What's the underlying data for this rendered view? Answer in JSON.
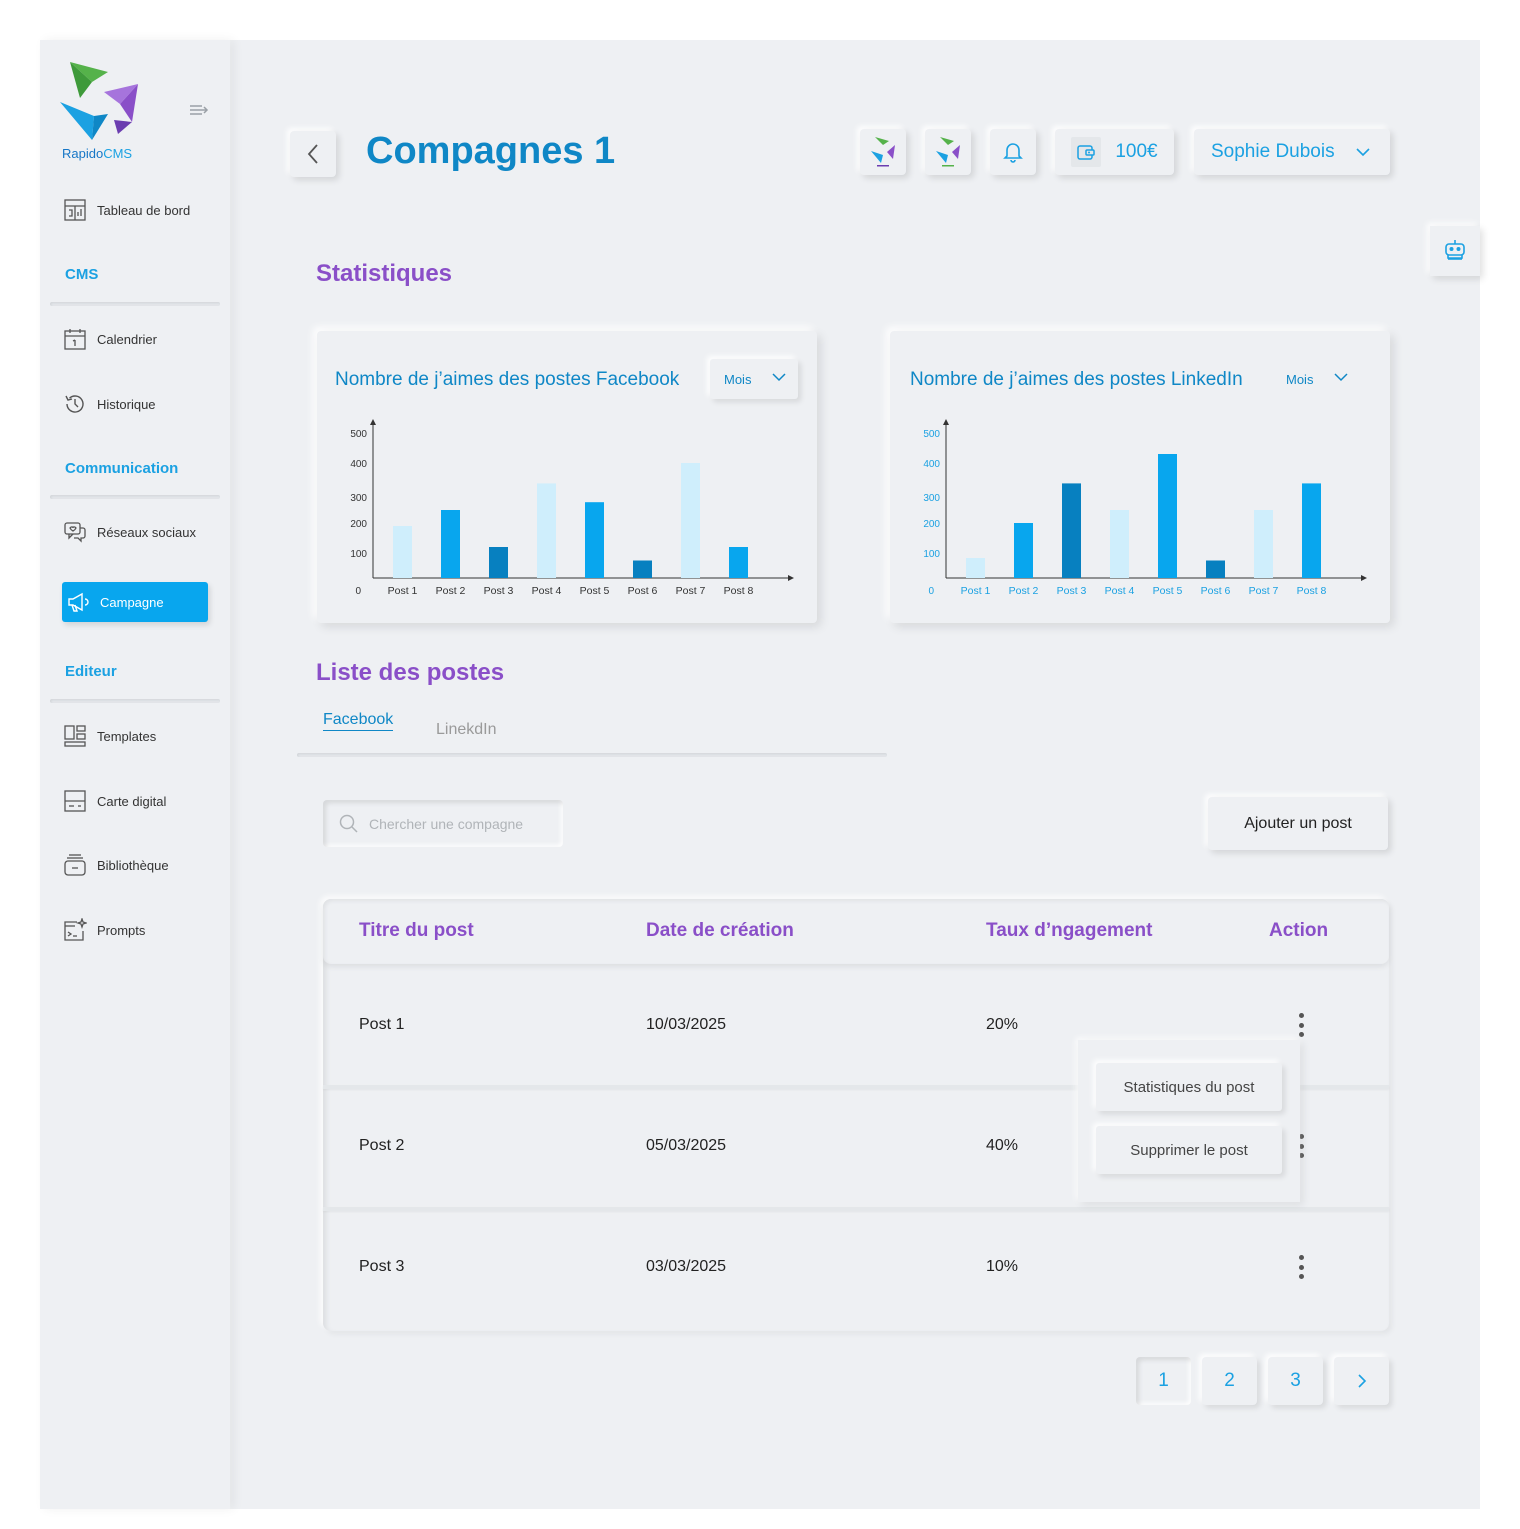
{
  "brand": {
    "name_part1": "Rapido",
    "name_part2": "CMS"
  },
  "sidebar": {
    "items": [
      {
        "label": "Tableau de bord",
        "icon": "dashboard-icon"
      },
      {
        "label": "Calendrier",
        "icon": "calendar-icon"
      },
      {
        "label": "Historique",
        "icon": "history-icon"
      },
      {
        "label": "Réseaux sociaux",
        "icon": "chat-icon"
      },
      {
        "label": "Campagne",
        "icon": "megaphone-icon",
        "active": true
      },
      {
        "label": "Templates",
        "icon": "templates-icon"
      },
      {
        "label": "Carte digital",
        "icon": "card-icon"
      },
      {
        "label": "Bibliothèque",
        "icon": "library-icon"
      },
      {
        "label": "Prompts",
        "icon": "prompts-icon"
      }
    ],
    "sections": {
      "cms": "CMS",
      "communication": "Communication",
      "editeur": "Editeur"
    }
  },
  "header": {
    "title": "Compagnes 1",
    "wallet_value": "100€",
    "user_name": "Sophie Dubois"
  },
  "sections": {
    "stats": "Statistiques",
    "posts": "Liste des postes"
  },
  "colors": {
    "primary": "#0f87c6",
    "accent": "#1ba1e2",
    "purple": "#8a4fc8",
    "bar_light": "#cfeefc",
    "bar_mid": "#08a6ee",
    "bar_dark": "#0780c0"
  },
  "chart_data": [
    {
      "type": "bar",
      "title": "Nombre de j’aimes des postes Facebook",
      "period": "Mois",
      "categories": [
        "Post 1",
        "Post 2",
        "Post 3",
        "Post 4",
        "Post 5",
        "Post 6",
        "Post 7",
        "Post 8"
      ],
      "values": [
        190,
        250,
        120,
        340,
        280,
        70,
        400,
        120
      ],
      "bar_colors": [
        "light",
        "mid",
        "dark",
        "light",
        "mid",
        "dark",
        "light",
        "mid"
      ],
      "yticks": [
        0,
        100,
        200,
        300,
        400,
        500
      ],
      "ylim": [
        0,
        500
      ]
    },
    {
      "type": "bar",
      "title": "Nombre de j’aimes des postes LinkedIn",
      "period": "Mois",
      "categories": [
        "Post 1",
        "Post 2",
        "Post 3",
        "Post 4",
        "Post 5",
        "Post 6",
        "Post 7",
        "Post 8"
      ],
      "values": [
        80,
        200,
        340,
        250,
        430,
        70,
        250,
        340
      ],
      "bar_colors": [
        "light",
        "mid",
        "dark",
        "light",
        "mid",
        "dark",
        "light",
        "mid"
      ],
      "yticks": [
        0,
        100,
        200,
        300,
        400,
        500
      ],
      "ylim": [
        0,
        500
      ]
    }
  ],
  "tabs": [
    {
      "label": "Facebook",
      "active": true
    },
    {
      "label": "LinekdIn",
      "active": false
    }
  ],
  "search": {
    "placeholder": "Chercher une compagne",
    "value": ""
  },
  "add_post_label": "Ajouter un post",
  "table": {
    "headers": [
      "Titre du post",
      "Date de création",
      "Taux d’ngagement",
      "Action"
    ],
    "rows": [
      {
        "title": "Post 1",
        "date": "10/03/2025",
        "rate": "20%"
      },
      {
        "title": "Post 2",
        "date": "05/03/2025",
        "rate": "40%"
      },
      {
        "title": "Post 3",
        "date": "03/03/2025",
        "rate": "10%"
      }
    ]
  },
  "row_menu": {
    "stats": "Statistiques du post",
    "delete": "Supprimer le post"
  },
  "pagination": {
    "pages": [
      "1",
      "2",
      "3"
    ],
    "current": "1",
    "next_icon": "chevron-right-icon"
  }
}
